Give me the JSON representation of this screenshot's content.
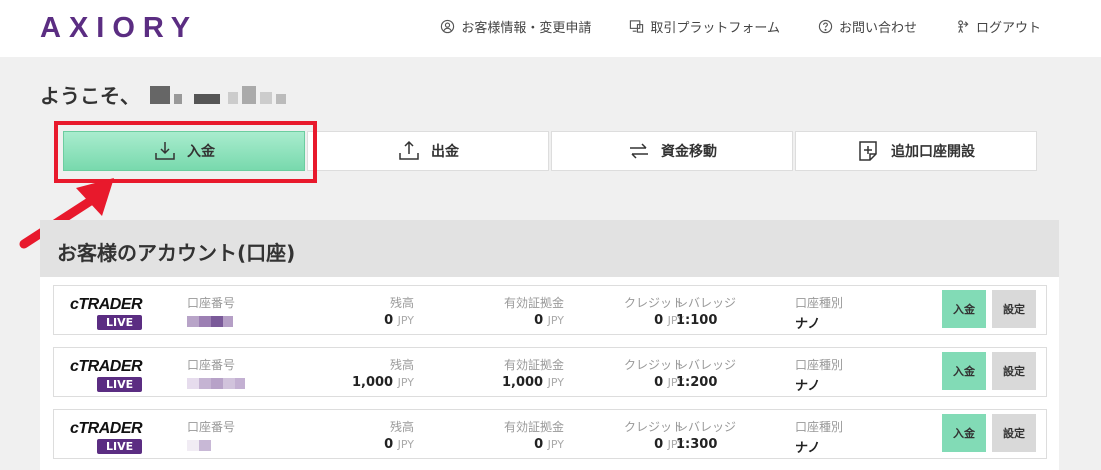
{
  "header": {
    "logo": "AXIORY",
    "nav": [
      {
        "label": "お客様情報・変更申請",
        "icon": "user-circle-icon"
      },
      {
        "label": "取引プラットフォーム",
        "icon": "monitor-icon"
      },
      {
        "label": "お問い合わせ",
        "icon": "question-circle-icon"
      },
      {
        "label": "ログアウト",
        "icon": "logout-icon"
      }
    ]
  },
  "welcome": "ようこそ、",
  "actions": {
    "deposit": "入金",
    "withdraw": "出金",
    "transfer": "資金移動",
    "open_account": "追加口座開設"
  },
  "accounts": {
    "title": "お客様のアカウント(口座)",
    "platform_name": "cTRADER",
    "platform_badge": "LIVE",
    "labels": {
      "account_number": "口座番号",
      "balance": "残高",
      "equity": "有効証拠金",
      "credit": "クレジット",
      "leverage": "レバレッジ",
      "type": "口座種別"
    },
    "currency": "JPY",
    "deposit_btn": "入金",
    "settings_btn": "設定",
    "rows": [
      {
        "balance": "0",
        "equity": "0",
        "credit": "0",
        "leverage": "1:100",
        "type": "ナノ"
      },
      {
        "balance": "1,000",
        "equity": "1,000",
        "credit": "0",
        "leverage": "1:200",
        "type": "ナノ"
      },
      {
        "balance": "0",
        "equity": "0",
        "credit": "0",
        "leverage": "1:300",
        "type": "ナノ"
      }
    ]
  },
  "colors": {
    "brand": "#5b2d82",
    "deposit_green": "#82dbb6",
    "highlight_red": "#e8192c"
  }
}
